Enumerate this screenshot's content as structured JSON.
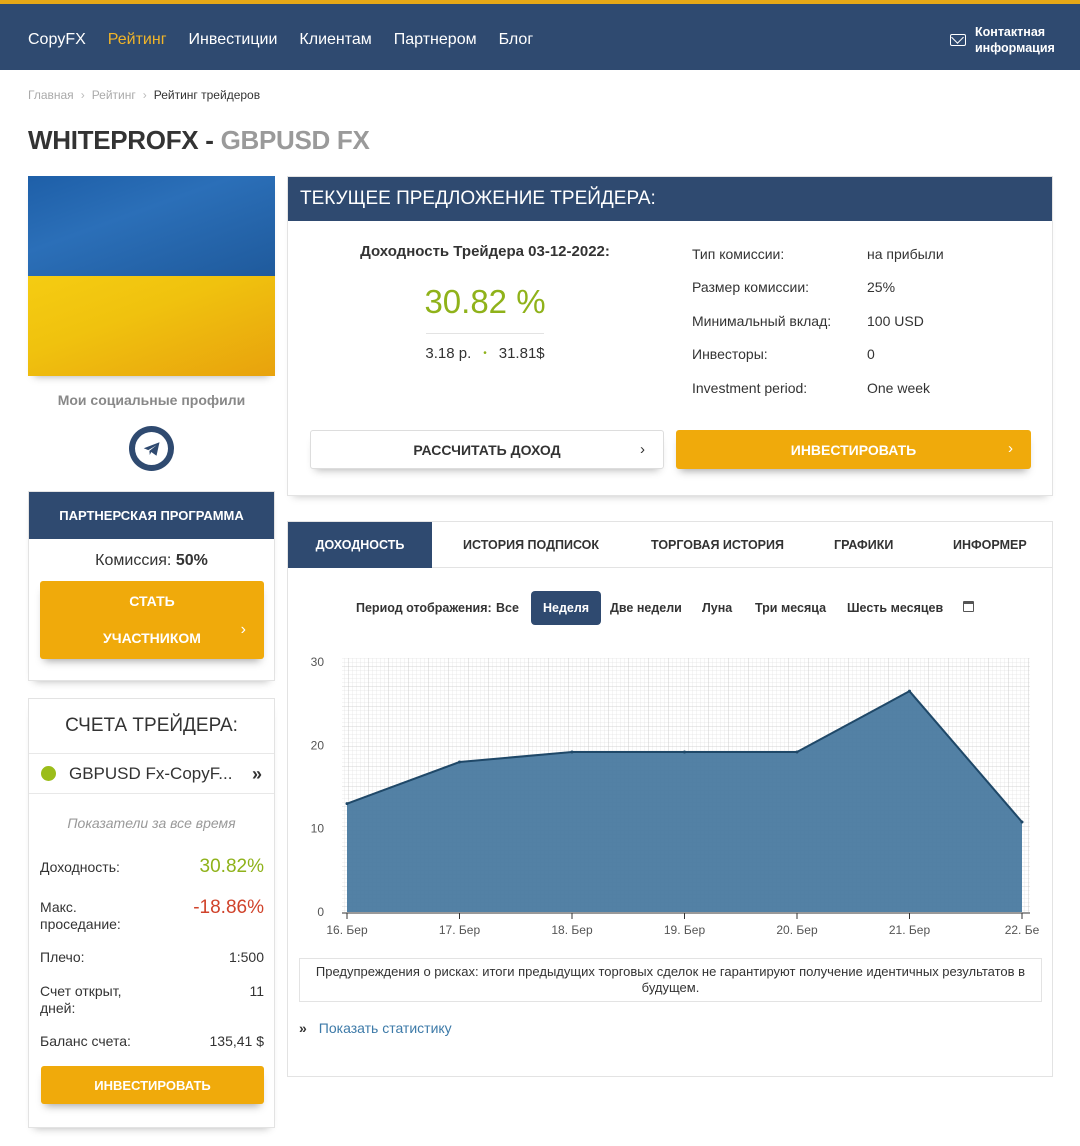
{
  "nav": {
    "items": [
      {
        "label": "CopyFX",
        "active": false
      },
      {
        "label": "Рейтинг",
        "active": true
      },
      {
        "label": "Инвестиции",
        "active": false
      },
      {
        "label": "Клиентам",
        "active": false
      },
      {
        "label": "Партнером",
        "active": false
      },
      {
        "label": "Блог",
        "active": false
      }
    ],
    "contact_line1": "Контактная",
    "contact_line2": "информация",
    "contact_icon": "mail-icon"
  },
  "breadcrumb": {
    "home": "Главная",
    "rating": "Рейтинг",
    "current": "Рейтинг трейдеров",
    "separator": "›"
  },
  "title": {
    "name": "WHITEPROFX",
    "dash": " - ",
    "account": "GBPUSD FX"
  },
  "profile": {
    "flag_colors": [
      "#2b6fb8",
      "#f0c20e"
    ],
    "social_title": "Мои социальные профили",
    "social_icon": "telegram-icon"
  },
  "partner": {
    "header": "ПАРТНЕРСКАЯ ПРОГРАММА",
    "commission_label": "Комиссия:",
    "commission_value": "50%",
    "join_line1": "СТАТЬ",
    "join_line2": "УЧАСТНИКОМ",
    "chevron": "›"
  },
  "accounts": {
    "header": "СЧЕТА ТРЕЙДЕРА:",
    "account_name": "GBPUSD Fx-CopyF...",
    "account_arrow": "»",
    "period": "Показатели за все время",
    "stats": {
      "yield_label": "Доходность:",
      "yield_value": "30.82%",
      "drawdown_label_1": "Макс.",
      "drawdown_label_2": "проседание:",
      "drawdown_value": "-18.86%",
      "leverage_label": "Плечо:",
      "leverage_value": "1:500",
      "days_label_1": "Счет открыт,",
      "days_label_2": "дней:",
      "days_value": "11",
      "balance_label": "Баланс счета:",
      "balance_value": "135,41 $"
    },
    "invest_label": "ИНВЕСТИРОВАТЬ"
  },
  "offer": {
    "header": "ТЕКУЩЕЕ ПРЕДЛОЖЕНИЕ ТРЕЙДЕРА:",
    "yield_title": "Доходность Трейдера 03-12-2022:",
    "yield_value": "30.82 %",
    "yield_sub_left": "3.18 р.",
    "yield_sub_bullet": "•",
    "yield_sub_right": "31.81$",
    "params": [
      {
        "key": "Тип комиссии:",
        "value": "на прибыли"
      },
      {
        "key": "Размер комиссии:",
        "value": "25%"
      },
      {
        "key": "Минимальный вклад:",
        "value": "100 USD"
      },
      {
        "key": "Инвесторы:",
        "value": "0"
      },
      {
        "key": "Investment period:",
        "value": "One week"
      }
    ],
    "calc_label": "РАССЧИТАТЬ ДОХОД",
    "invest_label": "ИНВЕСТИРОВАТЬ",
    "chevron": "›"
  },
  "tabs": [
    {
      "label": "ДОХОДНОСТЬ",
      "active": true
    },
    {
      "label": "ИСТОРИЯ ПОДПИСОК",
      "active": false
    },
    {
      "label": "ТОРГОВАЯ ИСТОРИЯ",
      "active": false
    },
    {
      "label": "ГРАФИКИ",
      "active": false
    },
    {
      "label": "ИНФОРМЕР",
      "active": false
    }
  ],
  "period_bar": {
    "label": "Период отображения:",
    "options": [
      "Все",
      "Неделя",
      "Две недели",
      "Луна",
      "Три месяца",
      "Шесть месяцев"
    ],
    "selected": "Неделя",
    "calendar_icon": "calendar-icon"
  },
  "chart_data": {
    "type": "area",
    "categories": [
      "16. Бер",
      "17. Бер",
      "18. Бер",
      "19. Бер",
      "20. Бер",
      "21. Бер",
      "22. Бе"
    ],
    "x": [
      0,
      1,
      2,
      3,
      4,
      5,
      6
    ],
    "values": [
      13,
      18,
      19.2,
      19.2,
      19.2,
      26.5,
      10.8
    ],
    "ylim": [
      0,
      30
    ],
    "yticks": [
      0,
      10,
      20,
      30
    ],
    "title": "",
    "xlabel": "",
    "ylabel": "",
    "grid": true,
    "fill_color": "#4a7aa0",
    "line_color": "#1f4868"
  },
  "risk_warning": "Предупреждения о рисках: итоги предыдущих торговых сделок не гарантируют получение идентичных результатов в будущем.",
  "show_stats": {
    "arrow": "»",
    "label": "Показать статистику"
  }
}
